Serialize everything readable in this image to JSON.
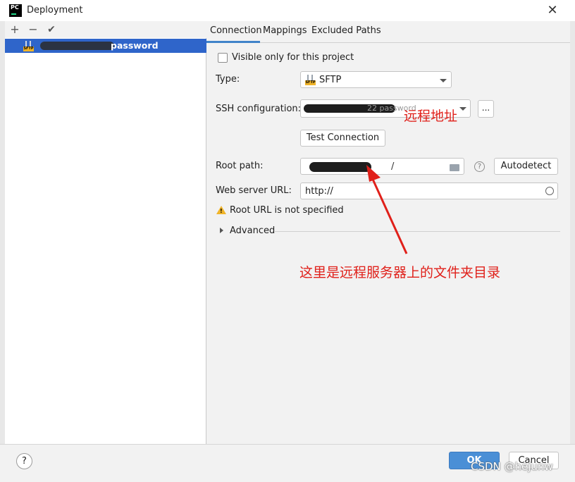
{
  "window": {
    "title": "Deployment",
    "close_glyph": "✕"
  },
  "toolbar": {
    "add": "+",
    "remove": "−",
    "apply": "✔"
  },
  "server": {
    "name": "password",
    "icon_label": "SFTP"
  },
  "tabs": [
    "Connection",
    "Mappings",
    "Excluded Paths"
  ],
  "connection": {
    "visible_only_label": "Visible only for this project",
    "type_label": "Type:",
    "type_value": "SFTP",
    "ssh_label": "SSH configuration:",
    "ssh_value_tail": "22 password",
    "more_btn": "...",
    "test_btn": "Test Connection",
    "root_label": "Root path:",
    "root_value_tail": "/",
    "autodetect_btn": "Autodetect",
    "help_glyph": "?",
    "web_url_label": "Web server URL:",
    "web_url_value": "http://",
    "warning_text": "Root URL is not specified",
    "advanced_label": "Advanced"
  },
  "annotations": {
    "remote_address": "远程地址",
    "remote_dir": "这里是远程服务器上的文件夹目录",
    "color": "#e0201a"
  },
  "footer": {
    "help": "?",
    "ok": "OK",
    "cancel": "Cancel",
    "watermark": "CSDN @hejunw"
  },
  "colors": {
    "selection": "#2f65ca",
    "ok": "#4a8fd6",
    "sftp_badge": "#f0b429"
  }
}
